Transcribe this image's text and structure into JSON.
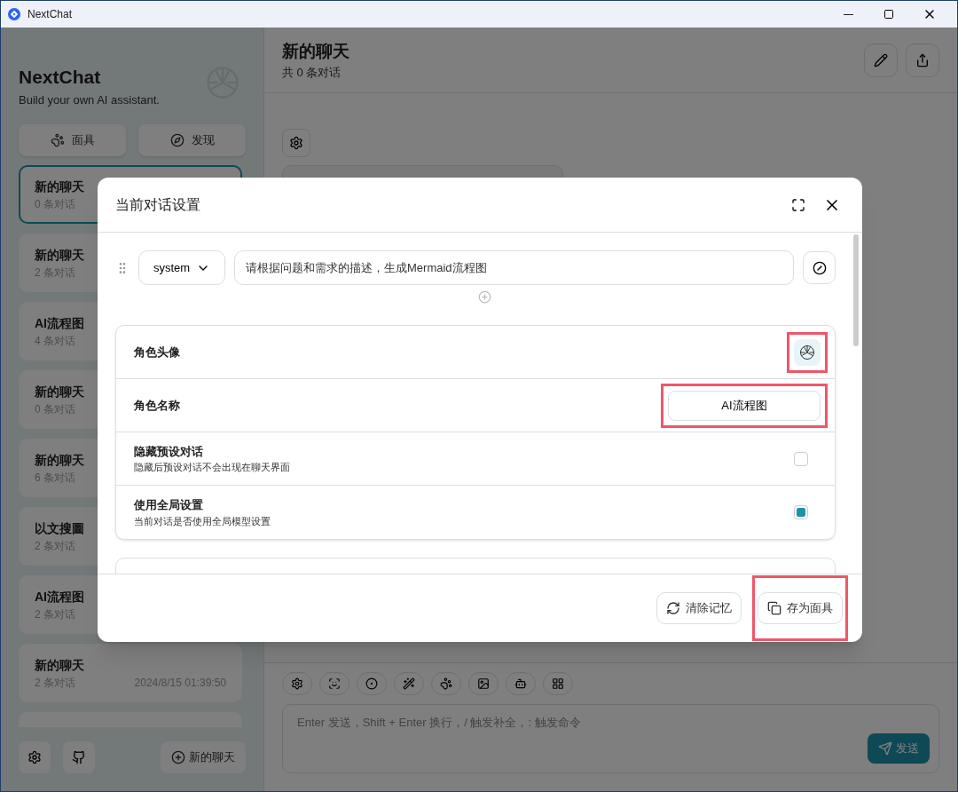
{
  "window": {
    "title": "NextChat"
  },
  "sidebar": {
    "title": "NextChat",
    "subtitle": "Build your own AI assistant.",
    "buttons": [
      {
        "label": "面具",
        "kind": "mask"
      },
      {
        "label": "发现",
        "kind": "discover"
      }
    ],
    "chats": [
      {
        "title": "新的聊天",
        "count": "0 条对话",
        "selected": true
      },
      {
        "title": "新的聊天",
        "count": "2 条对话",
        "selected": false
      },
      {
        "title": "AI流程图",
        "count": "4 条对话",
        "selected": false
      },
      {
        "title": "新的聊天",
        "count": "0 条对话",
        "selected": false
      },
      {
        "title": "新的聊天",
        "count": "6 条对话",
        "selected": false
      },
      {
        "title": "以文搜圖",
        "count": "2 条对话",
        "selected": false
      },
      {
        "title": "AI流程图",
        "count": "2 条对话",
        "selected": false
      },
      {
        "title": "新的聊天",
        "count": "2 条对话",
        "date": "2024/8/15 01:39:50",
        "selected": false
      }
    ],
    "new_chat": "新的聊天"
  },
  "chat": {
    "title": "新的聊天",
    "subtitle": "共 0 条对话",
    "input_placeholder": "Enter 发送，Shift + Enter 换行，/ 触发补全，: 触发命令",
    "send": "发送"
  },
  "dialog": {
    "title": "当前对话设置",
    "message": {
      "role": "system",
      "content": "请根据问题和需求的描述，生成Mermaid流程图"
    },
    "settings": [
      {
        "kind": "avatar",
        "label": "角色头像",
        "highlighted": true
      },
      {
        "kind": "text",
        "label": "角色名称",
        "value": "AI流程图",
        "highlighted": true
      },
      {
        "kind": "checkbox",
        "label": "隐藏预设对话",
        "description": "隐藏后预设对话不会出现在聊天界面",
        "checked": false
      },
      {
        "kind": "checkbox",
        "label": "使用全局设置",
        "description": "当前对话是否使用全局模型设置",
        "checked": true
      }
    ],
    "buttons": [
      {
        "label": "清除记忆",
        "kind": "clear",
        "highlighted": false
      },
      {
        "label": "存为面具",
        "kind": "save",
        "highlighted": true
      }
    ]
  }
}
